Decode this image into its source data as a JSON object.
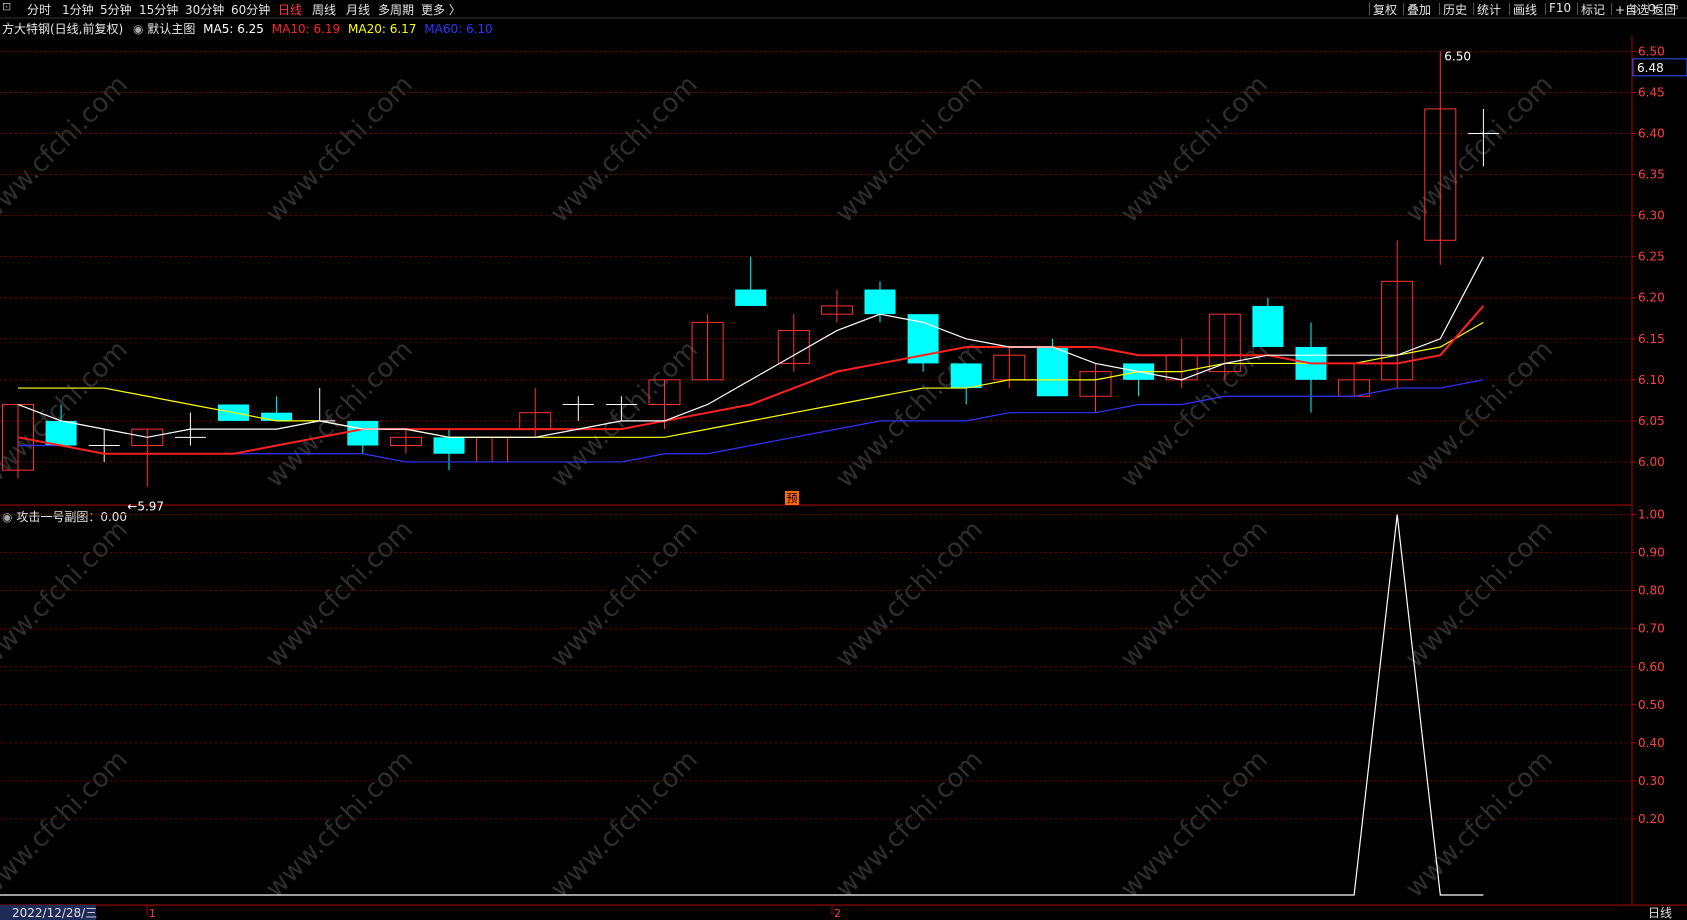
{
  "toolbar": {
    "periods": [
      "分时",
      "1分钟",
      "5分钟",
      "15分钟",
      "30分钟",
      "60分钟",
      "日线",
      "周线",
      "月线",
      "多周期",
      "更多 〉"
    ],
    "active_index": 6,
    "right_items": [
      "复权",
      "叠加",
      "历史",
      "统计",
      "画线",
      "F10",
      "标记",
      "+自选",
      "返回"
    ]
  },
  "main_legend": {
    "stock": "方大特钢(日线,前复权)",
    "panel": "默认主图",
    "ma5": "MA5: 6.25",
    "ma10": "MA10: 6.19",
    "ma20": "MA20: 6.17",
    "ma60": "MA60: 6.10"
  },
  "sub_legend": {
    "title": "攻击一号副图：0.00"
  },
  "labels": {
    "high_mark": "6.50",
    "low_mark": "←5.97",
    "pre_tag": "预",
    "last_price": "6.48"
  },
  "status_bar": {
    "date": "2022/12/28/三",
    "marker1": "1",
    "marker2": "2",
    "period": "日线"
  },
  "watermark": "www.cfchi.com",
  "colors": {
    "up": "#ff3232",
    "down": "#00ffff",
    "ma5": "#ffffff",
    "ma10": "#ff2020",
    "ma20": "#ffff00",
    "ma60": "#3333ff",
    "grid": "#7a0000",
    "axis": "#b00000"
  },
  "chart_data": [
    {
      "type": "candlestick",
      "title": "方大特钢(日线,前复权)",
      "ylim": [
        5.95,
        6.52
      ],
      "yticks": [
        6.0,
        6.05,
        6.1,
        6.15,
        6.2,
        6.25,
        6.3,
        6.35,
        6.4,
        6.45,
        6.5
      ],
      "candles": [
        {
          "o": 5.99,
          "h": 6.07,
          "l": 5.98,
          "c": 6.07
        },
        {
          "o": 6.05,
          "h": 6.07,
          "l": 6.02,
          "c": 6.02
        },
        {
          "o": 6.02,
          "h": 6.04,
          "l": 6.0,
          "c": 6.02
        },
        {
          "o": 6.02,
          "h": 6.04,
          "l": 5.97,
          "c": 6.04
        },
        {
          "o": 6.03,
          "h": 6.06,
          "l": 6.02,
          "c": 6.03
        },
        {
          "o": 6.07,
          "h": 6.07,
          "l": 6.05,
          "c": 6.05
        },
        {
          "o": 6.06,
          "h": 6.08,
          "l": 6.05,
          "c": 6.05
        },
        {
          "o": 6.05,
          "h": 6.09,
          "l": 6.05,
          "c": 6.05
        },
        {
          "o": 6.05,
          "h": 6.05,
          "l": 6.01,
          "c": 6.02
        },
        {
          "o": 6.02,
          "h": 6.04,
          "l": 6.01,
          "c": 6.03
        },
        {
          "o": 6.03,
          "h": 6.04,
          "l": 5.99,
          "c": 6.01
        },
        {
          "o": 6.0,
          "h": 6.03,
          "l": 6.0,
          "c": 6.03
        },
        {
          "o": 6.04,
          "h": 6.09,
          "l": 6.03,
          "c": 6.06
        },
        {
          "o": 6.07,
          "h": 6.08,
          "l": 6.05,
          "c": 6.07
        },
        {
          "o": 6.07,
          "h": 6.08,
          "l": 6.05,
          "c": 6.07
        },
        {
          "o": 6.07,
          "h": 6.1,
          "l": 6.04,
          "c": 6.1
        },
        {
          "o": 6.1,
          "h": 6.18,
          "l": 6.1,
          "c": 6.17
        },
        {
          "o": 6.21,
          "h": 6.25,
          "l": 6.19,
          "c": 6.19
        },
        {
          "o": 6.12,
          "h": 6.18,
          "l": 6.11,
          "c": 6.16
        },
        {
          "o": 6.18,
          "h": 6.21,
          "l": 6.17,
          "c": 6.19
        },
        {
          "o": 6.21,
          "h": 6.22,
          "l": 6.17,
          "c": 6.18
        },
        {
          "o": 6.18,
          "h": 6.18,
          "l": 6.11,
          "c": 6.12
        },
        {
          "o": 6.12,
          "h": 6.12,
          "l": 6.07,
          "c": 6.09
        },
        {
          "o": 6.1,
          "h": 6.14,
          "l": 6.09,
          "c": 6.13
        },
        {
          "o": 6.14,
          "h": 6.15,
          "l": 6.08,
          "c": 6.08
        },
        {
          "o": 6.08,
          "h": 6.12,
          "l": 6.06,
          "c": 6.11
        },
        {
          "o": 6.12,
          "h": 6.12,
          "l": 6.08,
          "c": 6.1
        },
        {
          "o": 6.1,
          "h": 6.15,
          "l": 6.09,
          "c": 6.13
        },
        {
          "o": 6.11,
          "h": 6.18,
          "l": 6.1,
          "c": 6.18
        },
        {
          "o": 6.19,
          "h": 6.2,
          "l": 6.14,
          "c": 6.14
        },
        {
          "o": 6.14,
          "h": 6.17,
          "l": 6.06,
          "c": 6.1
        },
        {
          "o": 6.08,
          "h": 6.12,
          "l": 6.08,
          "c": 6.1
        },
        {
          "o": 6.1,
          "h": 6.27,
          "l": 6.09,
          "c": 6.22
        },
        {
          "o": 6.27,
          "h": 6.5,
          "l": 6.24,
          "c": 6.43
        },
        {
          "o": 6.4,
          "h": 6.43,
          "l": 6.36,
          "c": 6.4
        }
      ],
      "ma5": [
        6.07,
        6.05,
        6.04,
        6.03,
        6.04,
        6.04,
        6.04,
        6.05,
        6.04,
        6.04,
        6.03,
        6.03,
        6.03,
        6.04,
        6.05,
        6.05,
        6.07,
        6.1,
        6.13,
        6.16,
        6.18,
        6.17,
        6.15,
        6.14,
        6.14,
        6.12,
        6.11,
        6.1,
        6.12,
        6.13,
        6.13,
        6.13,
        6.13,
        6.15,
        6.25
      ],
      "ma10": [
        6.03,
        6.02,
        6.01,
        6.01,
        6.01,
        6.01,
        6.02,
        6.03,
        6.04,
        6.04,
        6.04,
        6.04,
        6.04,
        6.04,
        6.04,
        6.05,
        6.06,
        6.07,
        6.09,
        6.11,
        6.12,
        6.13,
        6.14,
        6.14,
        6.14,
        6.14,
        6.13,
        6.13,
        6.13,
        6.13,
        6.12,
        6.12,
        6.12,
        6.13,
        6.19
      ],
      "ma20": [
        6.09,
        6.09,
        6.09,
        6.08,
        6.07,
        6.06,
        6.05,
        6.05,
        6.04,
        6.04,
        6.03,
        6.03,
        6.03,
        6.03,
        6.03,
        6.03,
        6.04,
        6.05,
        6.06,
        6.07,
        6.08,
        6.09,
        6.09,
        6.1,
        6.1,
        6.1,
        6.11,
        6.11,
        6.12,
        6.12,
        6.12,
        6.12,
        6.13,
        6.14,
        6.17
      ],
      "ma60": [
        6.02,
        6.02,
        6.01,
        6.01,
        6.01,
        6.01,
        6.01,
        6.01,
        6.01,
        6.0,
        6.0,
        6.0,
        6.0,
        6.0,
        6.0,
        6.01,
        6.01,
        6.02,
        6.03,
        6.04,
        6.05,
        6.05,
        6.05,
        6.06,
        6.06,
        6.06,
        6.07,
        6.07,
        6.08,
        6.08,
        6.08,
        6.08,
        6.09,
        6.09,
        6.1
      ]
    },
    {
      "type": "line",
      "title": "攻击一号副图",
      "ylim": [
        0,
        1.02
      ],
      "yticks": [
        0.2,
        0.3,
        0.4,
        0.5,
        0.6,
        0.7,
        0.8,
        0.9,
        1.0
      ],
      "values": [
        0,
        0,
        0,
        0,
        0,
        0,
        0,
        0,
        0,
        0,
        0,
        0,
        0,
        0,
        0,
        0,
        0,
        0,
        0,
        0,
        0,
        0,
        0,
        0,
        0,
        0,
        0,
        0,
        0,
        0,
        0,
        0,
        1,
        0,
        0
      ]
    }
  ]
}
